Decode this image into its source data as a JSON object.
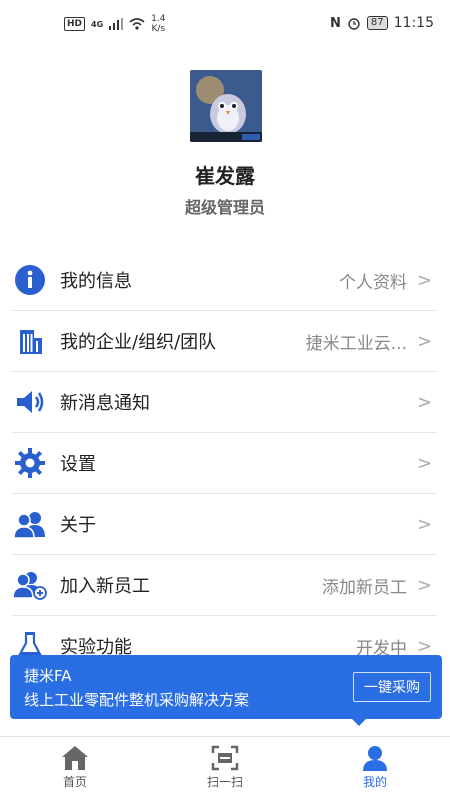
{
  "status_bar": {
    "hd": "HD",
    "network": "4G",
    "speed_value": "1.4",
    "speed_unit": "K/s",
    "battery": "87",
    "time": "11:15"
  },
  "profile": {
    "name": "崔发露",
    "role": "超级管理员"
  },
  "menu": [
    {
      "label": "我的信息",
      "value": "个人资料",
      "icon": "info-icon"
    },
    {
      "label": "我的企业/组织/团队",
      "value": "捷米工业云...",
      "icon": "building-icon"
    },
    {
      "label": "新消息通知",
      "value": "",
      "icon": "speaker-icon"
    },
    {
      "label": "设置",
      "value": "",
      "icon": "gear-icon"
    },
    {
      "label": "关于",
      "value": "",
      "icon": "people-icon"
    },
    {
      "label": "加入新员工",
      "value": "添加新员工",
      "icon": "add-user-icon"
    },
    {
      "label": "实验功能",
      "value": "开发中",
      "icon": "flask-icon"
    }
  ],
  "banner": {
    "title": "捷米FA",
    "subtitle": "线上工业零配件整机采购解决方案",
    "button": "一键采购"
  },
  "tabs": [
    {
      "label": "首页",
      "icon": "home-icon"
    },
    {
      "label": "扫一扫",
      "icon": "scan-icon"
    },
    {
      "label": "我的",
      "icon": "user-icon",
      "active": true
    }
  ],
  "colors": {
    "accent": "#2a6ee3",
    "icon_blue": "#2a5fd0"
  }
}
